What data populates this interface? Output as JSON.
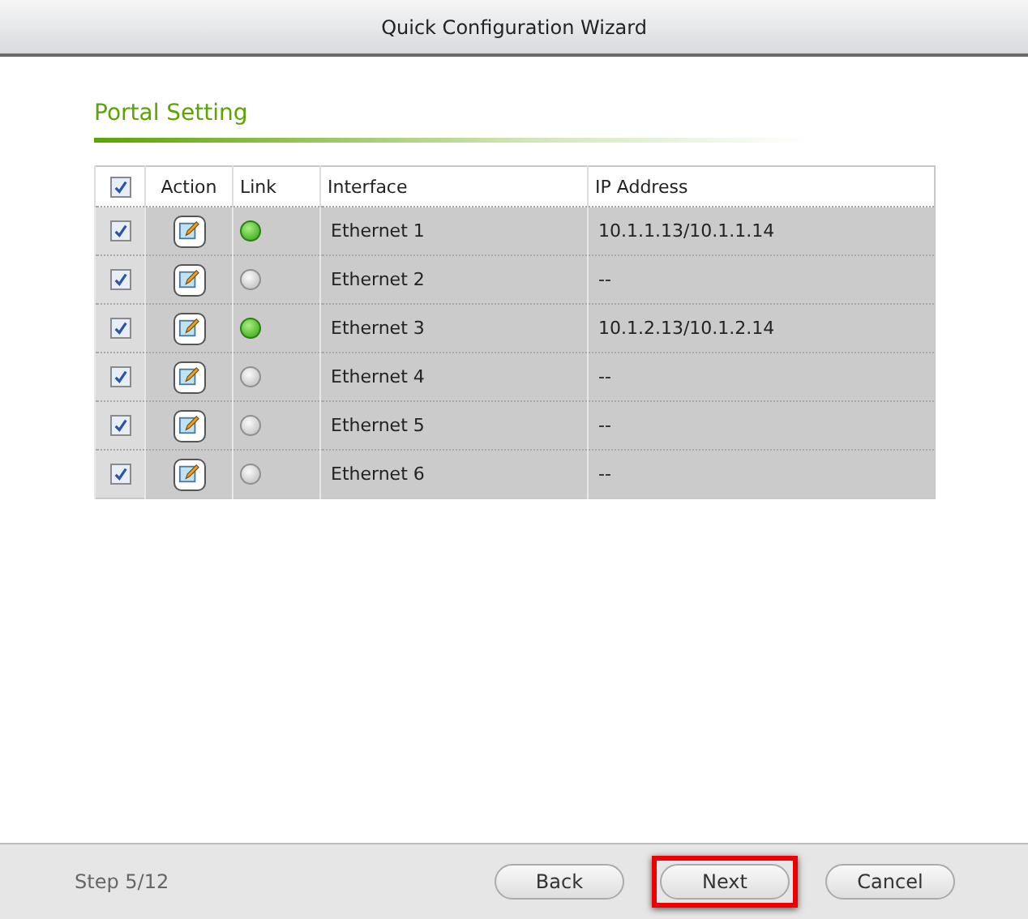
{
  "window": {
    "title": "Quick Configuration Wizard"
  },
  "section_title": "Portal Setting",
  "table": {
    "select_all": {
      "checked": true
    },
    "columns": [
      "Action",
      "Link",
      "Interface",
      "IP Address"
    ],
    "rows": [
      {
        "checked": true,
        "link_up": true,
        "interface": "Ethernet 1",
        "ip_address": "10.1.1.13/10.1.1.14"
      },
      {
        "checked": true,
        "link_up": false,
        "interface": "Ethernet 2",
        "ip_address": "--"
      },
      {
        "checked": true,
        "link_up": true,
        "interface": "Ethernet 3",
        "ip_address": "10.1.2.13/10.1.2.14"
      },
      {
        "checked": true,
        "link_up": false,
        "interface": "Ethernet 4",
        "ip_address": "--"
      },
      {
        "checked": true,
        "link_up": false,
        "interface": "Ethernet 5",
        "ip_address": "--"
      },
      {
        "checked": true,
        "link_up": false,
        "interface": "Ethernet 6",
        "ip_address": "--"
      }
    ]
  },
  "footer": {
    "step": "Step 5/12",
    "buttons": [
      {
        "label": "Back",
        "highlighted": false
      },
      {
        "label": "Next",
        "highlighted": true
      },
      {
        "label": "Cancel",
        "highlighted": false
      }
    ]
  }
}
